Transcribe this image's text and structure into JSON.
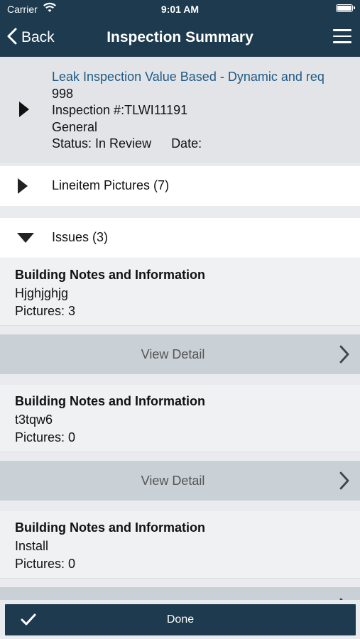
{
  "status_bar": {
    "carrier": "Carrier",
    "time": "9:01 AM"
  },
  "nav": {
    "back_label": "Back",
    "title": "Inspection Summary"
  },
  "summary": {
    "title": "Leak Inspection Value Based - Dynamic and req",
    "number": "998",
    "inspection": "Inspection #:TLWI11191",
    "category": "General",
    "status": "Status: In Review",
    "date": "Date:"
  },
  "sections": {
    "pictures": "Lineitem Pictures (7)",
    "issues": "Issues (3)"
  },
  "issues": [
    {
      "heading": "Building Notes and Information",
      "note": "Hjghjghjg",
      "pictures": "Pictures: 3"
    },
    {
      "heading": "Building Notes and Information",
      "note": "t3tqw6",
      "pictures": "Pictures: 0"
    },
    {
      "heading": "Building Notes and Information",
      "note": "Install",
      "pictures": "Pictures: 0"
    }
  ],
  "view_detail_label": "View Detail",
  "done_label": "Done",
  "colors": {
    "nav_bg": "#1d3a4e",
    "title_link": "#1e5a86",
    "detail_bar": "#c9d0d6"
  }
}
